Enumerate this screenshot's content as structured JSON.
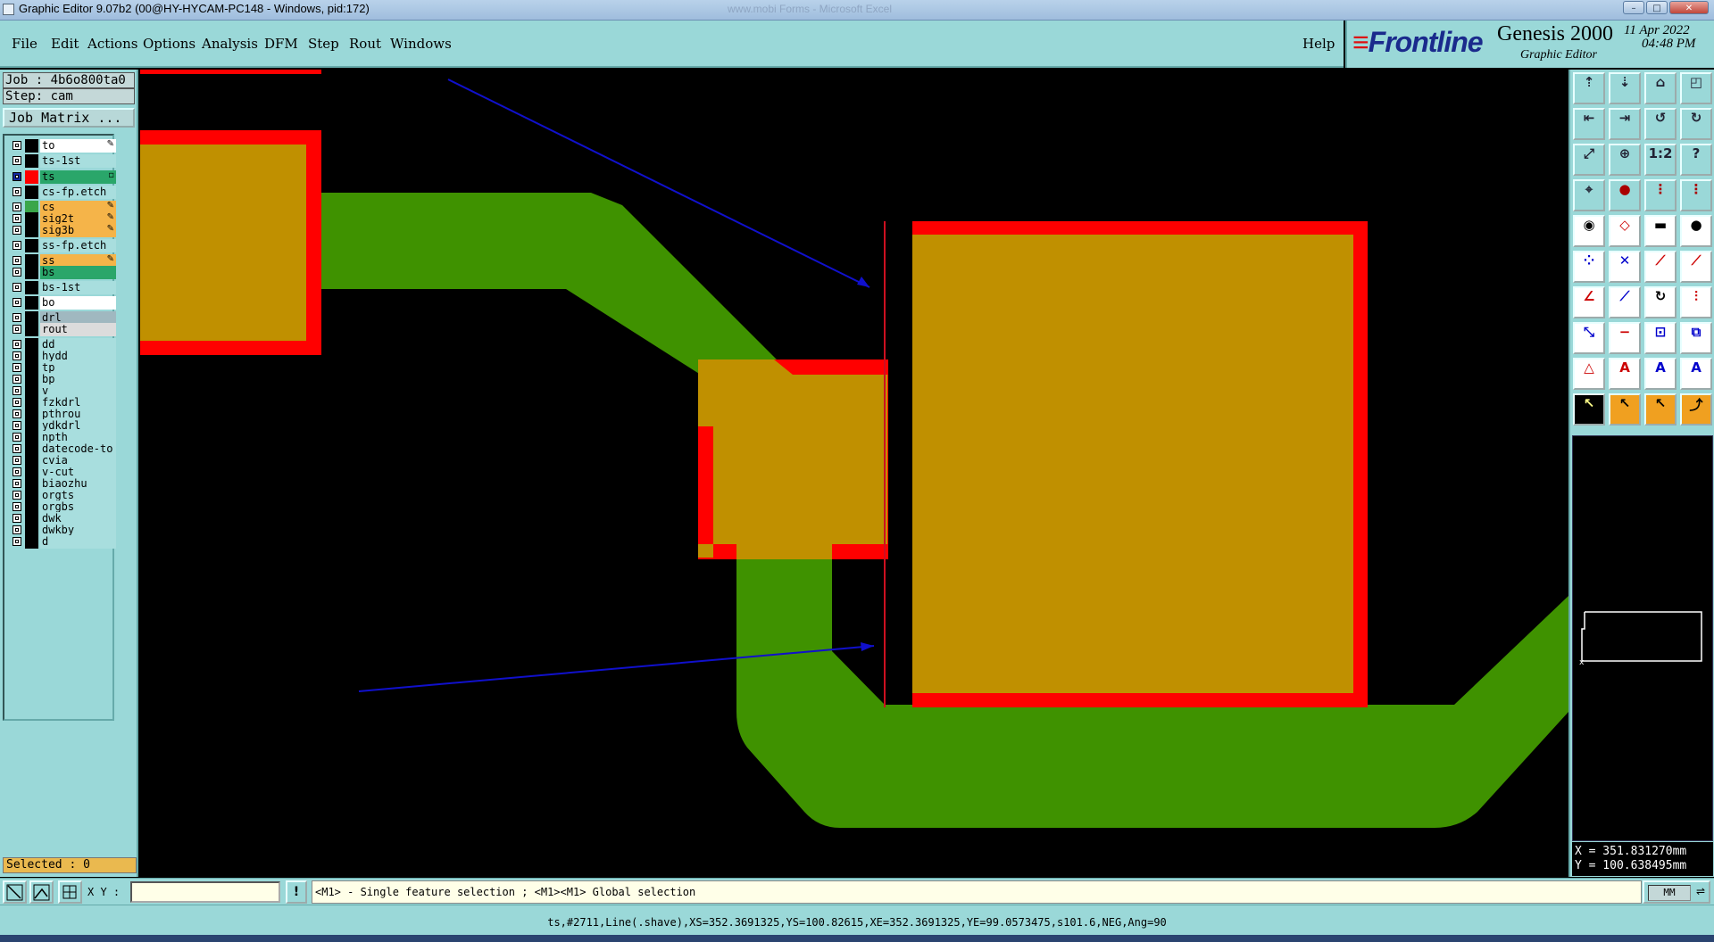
{
  "window": {
    "title": "Graphic Editor 9.07b2 (00@HY-HYCAM-PC148 - Windows, pid:172)",
    "ghost_title": "www.mobi Forms - Microsoft Excel",
    "controls": [
      "minimize",
      "maximize",
      "close"
    ]
  },
  "menu": {
    "items": [
      "File",
      "Edit",
      "Actions",
      "Options",
      "Analysis",
      "DFM",
      "Step",
      "Rout",
      "Windows"
    ],
    "help": "Help"
  },
  "branding": {
    "logo": "Frontline",
    "product": "Genesis 2000",
    "subtitle": "Graphic Editor",
    "date": "11 Apr 2022",
    "time": "04:48 PM"
  },
  "job": {
    "job_label": "Job : 4b6o800ta0",
    "step_label": "Step: cam",
    "matrix_button": "Job Matrix ..."
  },
  "layers": [
    {
      "name": "to",
      "swatch": "#000000",
      "bg": "#ffffff",
      "mark": "✎"
    },
    {
      "name": "ts-1st",
      "swatch": "#000000",
      "bg": "#a8dede",
      "mark": ""
    },
    {
      "name": "ts",
      "swatch": "#ff0000",
      "bg": "#2aa66a",
      "mark": "▫",
      "active": true
    },
    {
      "name": "cs-fp.etch",
      "swatch": "#000000",
      "bg": "#a8dede",
      "mark": ""
    },
    {
      "name": "cs",
      "swatch": "#3aa64a",
      "bg": "#f5b449",
      "mark": "✎"
    },
    {
      "name": "sig2t",
      "swatch": "#000000",
      "bg": "#f5b449",
      "mark": "✎"
    },
    {
      "name": "sig3b",
      "swatch": "#000000",
      "bg": "#f5b449",
      "mark": "✎"
    },
    {
      "name": "ss-fp.etch",
      "swatch": "#000000",
      "bg": "#a8dede",
      "mark": ""
    },
    {
      "name": "ss",
      "swatch": "#000000",
      "bg": "#f5b449",
      "mark": "✎"
    },
    {
      "name": "bs",
      "swatch": "#000000",
      "bg": "#2aa66a",
      "mark": ""
    },
    {
      "name": "bs-1st",
      "swatch": "#000000",
      "bg": "#a8dede",
      "mark": ""
    },
    {
      "name": "bo",
      "swatch": "#000000",
      "bg": "#ffffff",
      "mark": ""
    },
    {
      "name": "drl",
      "swatch": "#000000",
      "bg": "#a0b8c0",
      "mark": ""
    },
    {
      "name": "rout",
      "swatch": "#000000",
      "bg": "#dcdcdc",
      "mark": ""
    },
    {
      "name": "dd",
      "swatch": "#000000",
      "bg": "#a8dede",
      "mark": ""
    },
    {
      "name": "hydd",
      "swatch": "#000000",
      "bg": "#a8dede",
      "mark": ""
    },
    {
      "name": "tp",
      "swatch": "#000000",
      "bg": "#a8dede",
      "mark": ""
    },
    {
      "name": "bp",
      "swatch": "#000000",
      "bg": "#a8dede",
      "mark": ""
    },
    {
      "name": "v",
      "swatch": "#000000",
      "bg": "#a8dede",
      "mark": ""
    },
    {
      "name": "fzkdrl",
      "swatch": "#000000",
      "bg": "#a8dede",
      "mark": ""
    },
    {
      "name": "pthrou",
      "swatch": "#000000",
      "bg": "#a8dede",
      "mark": ""
    },
    {
      "name": "ydkdrl",
      "swatch": "#000000",
      "bg": "#a8dede",
      "mark": ""
    },
    {
      "name": "npth",
      "swatch": "#000000",
      "bg": "#a8dede",
      "mark": ""
    },
    {
      "name": "datecode-to",
      "swatch": "#000000",
      "bg": "#a8dede",
      "mark": ""
    },
    {
      "name": "cvia",
      "swatch": "#000000",
      "bg": "#a8dede",
      "mark": ""
    },
    {
      "name": "v-cut",
      "swatch": "#000000",
      "bg": "#a8dede",
      "mark": ""
    },
    {
      "name": "biaozhu",
      "swatch": "#000000",
      "bg": "#a8dede",
      "mark": ""
    },
    {
      "name": "orgts",
      "swatch": "#000000",
      "bg": "#a8dede",
      "mark": ""
    },
    {
      "name": "orgbs",
      "swatch": "#000000",
      "bg": "#a8dede",
      "mark": ""
    },
    {
      "name": "dwk",
      "swatch": "#000000",
      "bg": "#a8dede",
      "mark": ""
    },
    {
      "name": "dwkby",
      "swatch": "#000000",
      "bg": "#a8dede",
      "mark": ""
    },
    {
      "name": "d",
      "swatch": "#000000",
      "bg": "#a8dede",
      "mark": ""
    }
  ],
  "selection": {
    "label": "Selected : 0"
  },
  "coordinates": {
    "x": "X = 351.831270mm",
    "y": "Y = 100.638495mm"
  },
  "bottom": {
    "xy_label": "X Y :",
    "xy_value": "",
    "hint": "<M1> - Single feature selection ; <M1><M1> Global selection",
    "units": "MM"
  },
  "status": {
    "feature_info": "ts,#2711,Line(.shave),XS=352.3691325,YS=100.82615,XE=352.3691325,YE=99.0573475,s101.6,NEG,Ang=90"
  },
  "colors": {
    "panel": "#9ad8d8",
    "canvas": "#000000",
    "pad_fill": "#c09000",
    "pad_outline": "#ff0000",
    "trace": "#3f9200",
    "arrow": "#1010cc"
  },
  "tools": [
    "open-layer-icon",
    "save-icon",
    "home-icon",
    "zoom-window-icon",
    "pan-left-icon",
    "pan-right-icon",
    "undo-view-icon",
    "redo-view-icon",
    "zoom-fit-icon",
    "zoom-center-icon",
    "scale-1to2-icon",
    "help-icon",
    "snap-icon",
    "pad-measure-icon",
    "net-icon",
    "net-config-icon",
    "add-pad-icon",
    "edit-shape-icon",
    "ruler-icon",
    "circle-icon",
    "connect-icon",
    "cross-icon",
    "line-add-icon",
    "line-delete-icon",
    "angle-icon",
    "slash-icon",
    "rotate-icon",
    "split-icon",
    "resize-icon",
    "minus-icon",
    "center-icon",
    "copy-icon",
    "triangle-icon",
    "text-a-icon",
    "text-a-bold-icon",
    "text-a-alt-icon",
    "select-arrow-icon",
    "select-arrow-alt-icon",
    "select-arrow-hand-icon",
    "select-path-icon"
  ]
}
